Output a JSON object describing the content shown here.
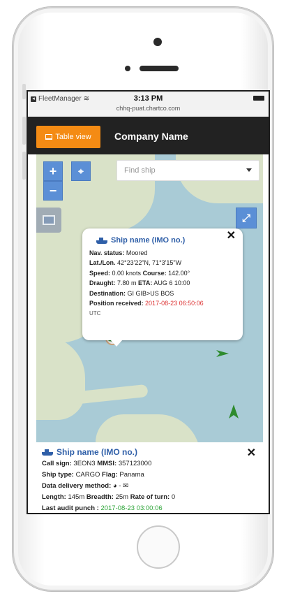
{
  "statusbar": {
    "carrier": "FleetManager",
    "time": "3:13 PM",
    "url": "chhq-puat.chartco.com"
  },
  "appbar": {
    "table_view_label": "Table view",
    "company_name": "Company Name"
  },
  "map": {
    "zoom_in": "+",
    "zoom_out": "−",
    "find_ship_placeholder": "Find ship",
    "popup": {
      "title": "Ship name (IMO no.)",
      "nav_status_label": "Nav. status:",
      "nav_status": "Moored",
      "latlon_label": "Lat./Lon.",
      "latlon": "42°23'22\"N,  71°3'15\"W",
      "speed_label": "Speed:",
      "speed": "0.00 knots",
      "course_label": "Course:",
      "course": "142.00°",
      "draught_label": "Draught:",
      "draught": "7.80 m",
      "eta_label": "ETA:",
      "eta": "AUG 6 10:00",
      "destination_label": "Destination:",
      "destination": "GI GIB>US BOS",
      "position_label": "Position received:",
      "position_time": "2017-08-23 06:50:06",
      "tz": "UTC",
      "close": "✕"
    }
  },
  "panel": {
    "title": "Ship name (IMO no.)",
    "close": "✕",
    "call_sign_label": "Call sign:",
    "call_sign": "3EON3",
    "mmsi_label": "MMSI:",
    "mmsi": "357123000",
    "ship_type_label": "Ship type:",
    "ship_type": "CARGO",
    "flag_label": "Flag:",
    "flag": "Panama",
    "delivery_label": "Data delivery method:",
    "delivery_icons": "◕ - ✉",
    "length_label": "Length:",
    "length": "145m",
    "breadth_label": "Breadth:",
    "breadth": "25m",
    "rot_label": "Rate of turn:",
    "rot": "0",
    "audit_label": "Last audit punch :",
    "audit": "2017-08-23 03:00:06"
  },
  "colors": {
    "accent_orange": "#f48b14",
    "appbar_dark": "#222222",
    "link_blue": "#2f5fa8",
    "marker_green": "#2e8b2e"
  }
}
